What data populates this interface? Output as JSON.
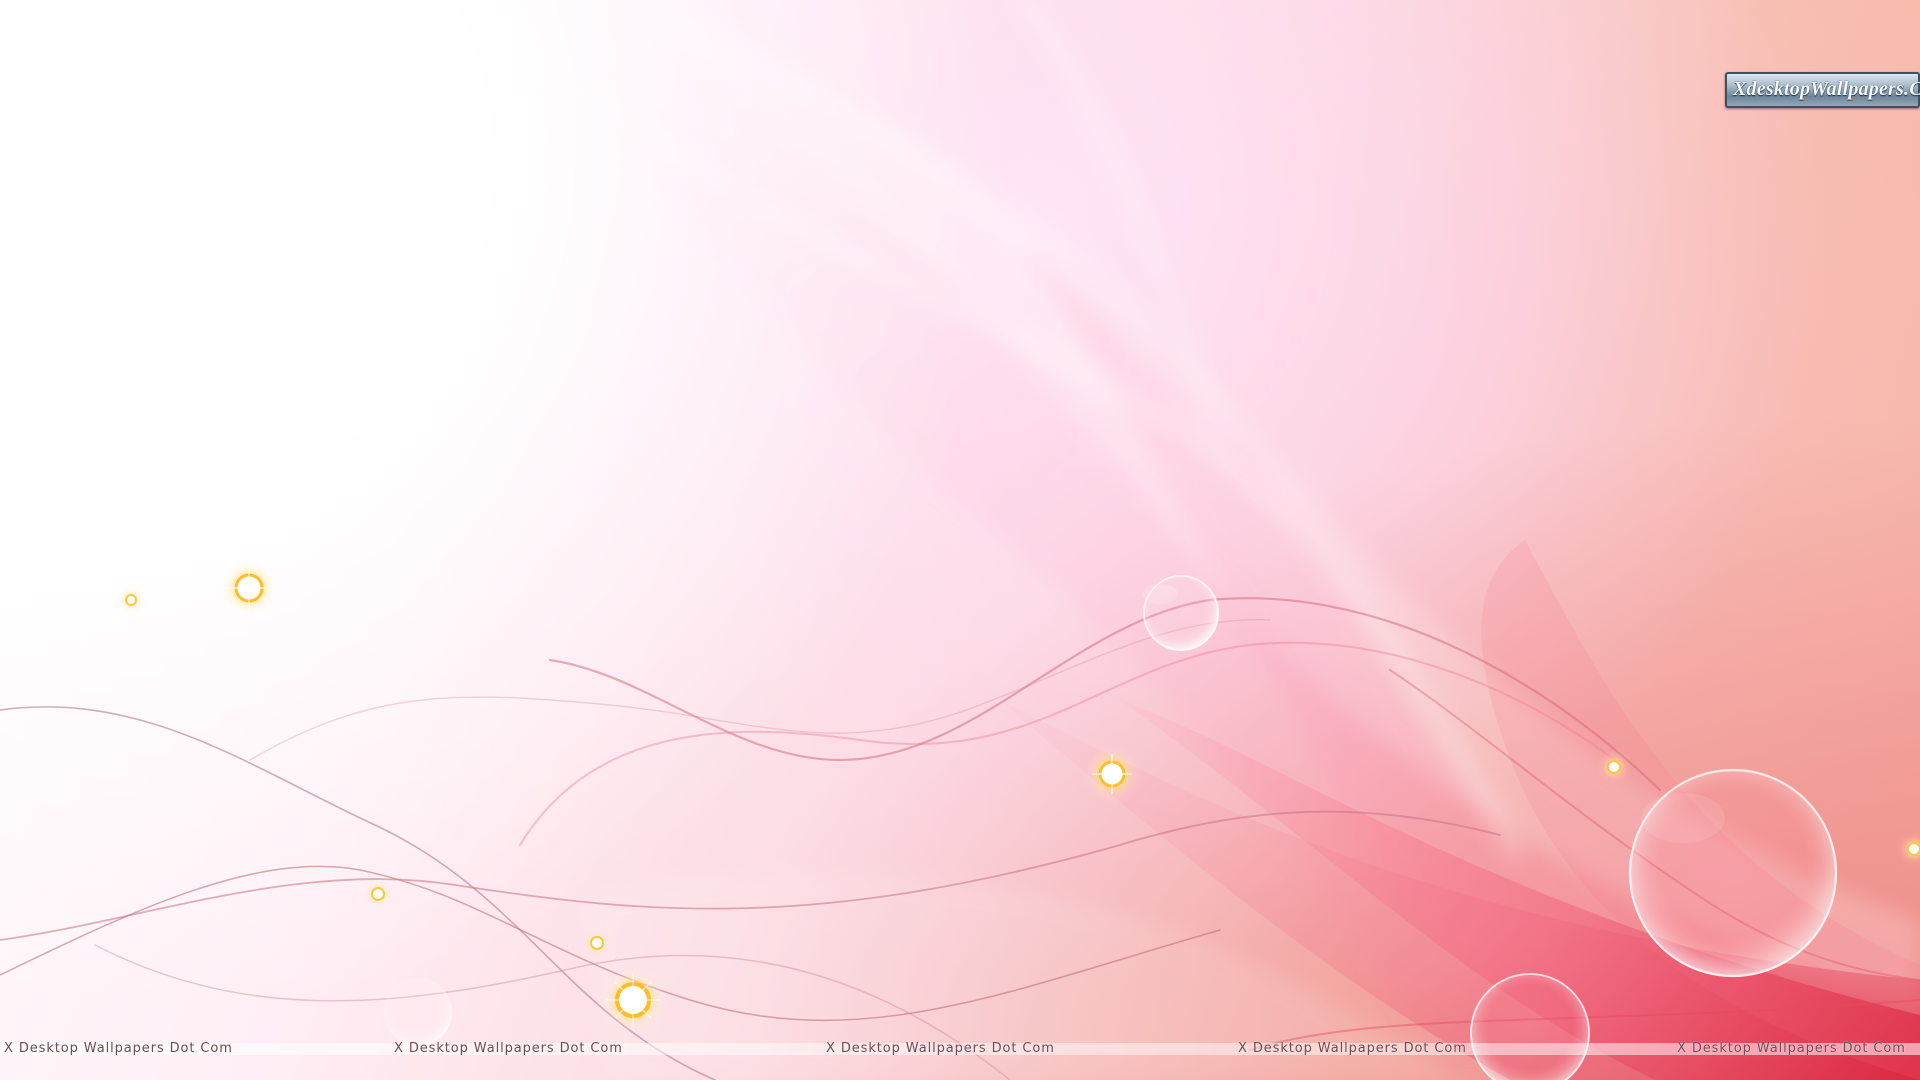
{
  "wallpaper": {
    "logo_text": "XdesktopWallpapers.Com",
    "footer_watermarks": [
      "X Desktop Wallpapers Dot Com",
      "X Desktop Wallpapers Dot Com",
      "X Desktop Wallpapers Dot Com",
      "X Desktop Wallpapers Dot Com",
      "X Desktop Wallpapers Dot Com"
    ],
    "colors": {
      "highlight": "#ffffff",
      "light_pink": "#fbd6db",
      "peach": "#f6b3a4",
      "rose": "#e03a53",
      "sparkle": "#ffd34d"
    }
  }
}
